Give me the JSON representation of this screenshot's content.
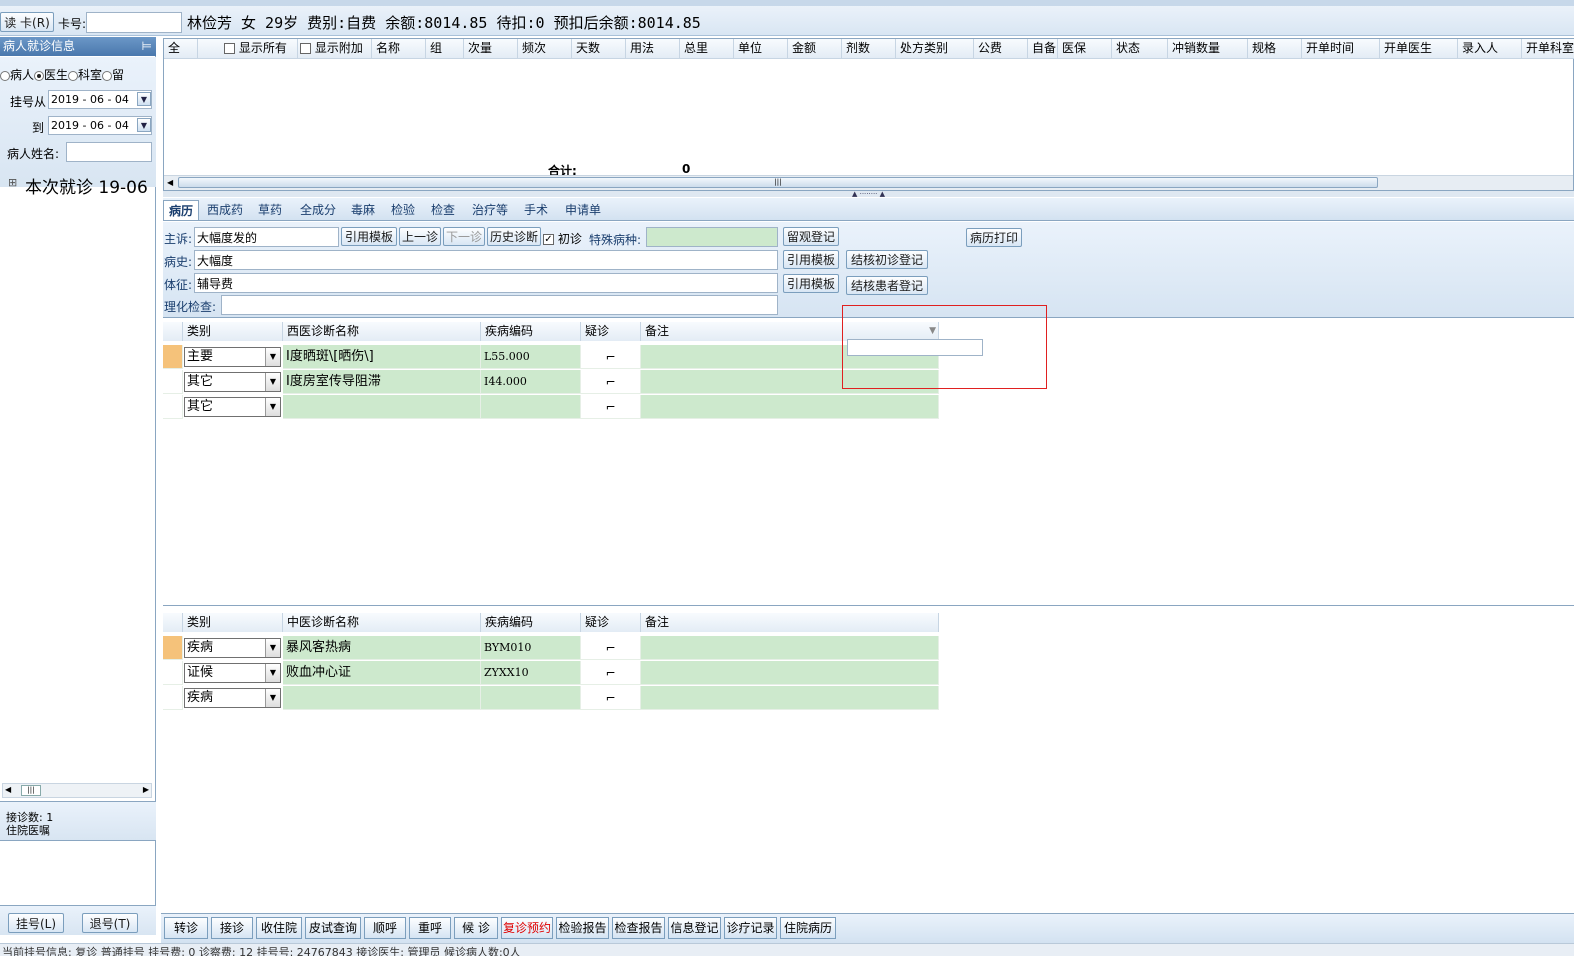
{
  "topbar": {
    "read_card": "读 卡(R)",
    "card_label": "卡号:",
    "card_value": "",
    "patient_info": "林俭芳 女 29岁 费别:自费 余额:8014.85 待扣:0 预扣后余额:8014.85"
  },
  "left": {
    "header": "病人就诊信息",
    "pin": "⊨",
    "radios": [
      "病人",
      "医生",
      "科室",
      "留"
    ],
    "reg_from_label": "挂号从",
    "reg_from": "2019 - 06 - 04",
    "reg_to_label": "到",
    "reg_to": "2019 - 06 - 04",
    "name_label": "病人姓名:",
    "name_value": "",
    "tree_item": "本次就诊  19-06",
    "count": "接诊数: 1",
    "note": "住院医嘱",
    "btn_register": "挂号(L)",
    "btn_unregister": "退号(T)"
  },
  "rx_grid": {
    "all": "全",
    "show_all": "显示所有",
    "show_extra": "显示附加",
    "columns": [
      "名称",
      "组",
      "次量",
      "频次",
      "天数",
      "用法",
      "总里",
      "单位",
      "金额",
      "剂数",
      "处方类别",
      "公费",
      "自备",
      "医保",
      "状态",
      "冲销数量",
      "规格",
      "开单时间",
      "开单医生",
      "录入人",
      "开单科室"
    ],
    "total_label": "合计:",
    "total_value": "0"
  },
  "tabs": [
    "病历",
    "西成药",
    "草药",
    "全成分",
    "毒麻",
    "检验",
    "检查",
    "治疗等",
    "手术",
    "申请单"
  ],
  "record": {
    "complaint_label": "主诉:",
    "complaint": "大幅度发的",
    "btn_template1": "引用模板",
    "btn_prev": "上一诊",
    "btn_next": "下一诊",
    "btn_history": "历史诊断",
    "first_visit": "初诊",
    "special_label": "特殊病种:",
    "btn_observe": "留观登记",
    "btn_print": "病历打印",
    "history_label": "病史:",
    "history": "大幅度",
    "btn_template2": "引用模板",
    "btn_tb_first": "结核初诊登记",
    "sign_label": "体征:",
    "sign": "辅导费",
    "btn_template3": "引用模板",
    "btn_tb_patient": "结核患者登记",
    "lab_label": "理化检查:",
    "lab": ""
  },
  "west_diag": {
    "headers": [
      "类别",
      "西医诊断名称",
      "疾病编码",
      "疑诊",
      "备注"
    ],
    "rows": [
      {
        "type": "主要",
        "name": "Ⅰ度晒斑\\[晒伤\\]",
        "code": "L55.000"
      },
      {
        "type": "其它",
        "name": "Ⅰ度房室传导阻滞",
        "code": "I44.000"
      },
      {
        "type": "其它",
        "name": "",
        "code": ""
      }
    ]
  },
  "tcm_diag": {
    "headers": [
      "类别",
      "中医诊断名称",
      "疾病编码",
      "疑诊",
      "备注"
    ],
    "rows": [
      {
        "type": "疾病",
        "name": "暴风客热病",
        "code": "BYM010"
      },
      {
        "type": "证候",
        "name": "败血冲心证",
        "code": "ZYXX10"
      },
      {
        "type": "疾病",
        "name": "",
        "code": ""
      }
    ]
  },
  "bottom_buttons": [
    "转诊",
    "接诊",
    "收住院",
    "皮试查询",
    "顺呼",
    "重呼",
    "候 诊",
    "复诊预约",
    "检验报告",
    "检查报告",
    "信息登记",
    "诊疗记录",
    "住院病历"
  ],
  "status_bar": "当前挂号信息: 复诊 普通挂号        挂号费: 0        诊察费: 12        挂号号: 24767843     接诊医生: 管理员        候诊病人数:0人",
  "colors": {
    "accent_red": "#e00000",
    "grid_green": "#cde9cd",
    "header_blue": "#4a78ad"
  }
}
